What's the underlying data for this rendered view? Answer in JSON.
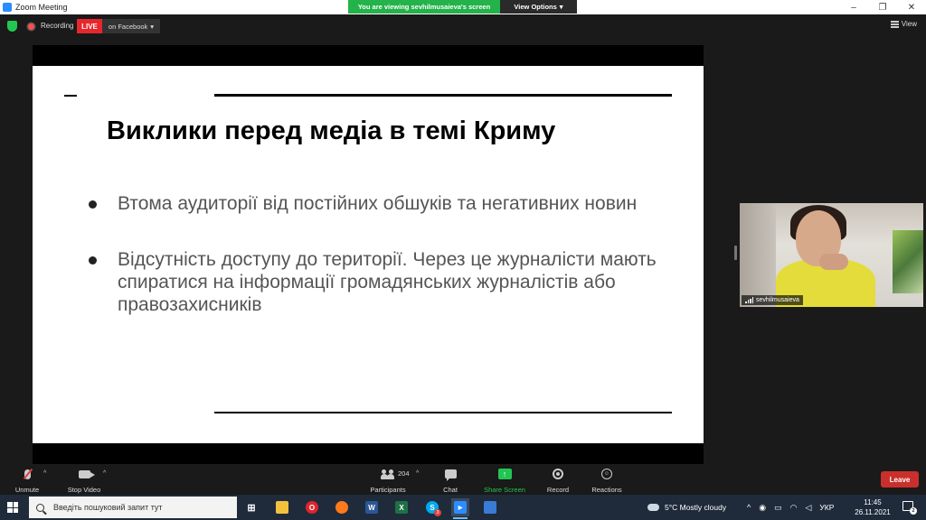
{
  "window": {
    "title": "Zoom Meeting",
    "controls": {
      "minimize": "–",
      "restore": "❐",
      "close": "✕"
    }
  },
  "share_banner": {
    "viewing_text": "You are viewing sevhilmusaieva's screen",
    "view_options_label": "View Options",
    "chevron": "▾"
  },
  "meeting": {
    "recording_label": "Recording",
    "live_label": "LIVE",
    "live_destination": "on Facebook",
    "dropdown_chevron": "▾",
    "view_label": "View"
  },
  "slide": {
    "heading": "Виклики перед медіа в темі Криму",
    "bullets": [
      "Втома аудиторії від постійних обшуків та негативних новин",
      "Відсутність доступу до території. Через це журналісти мають спиратися на інформації громадянських журналістів або правозахисників"
    ]
  },
  "participant": {
    "name": "sevhilmusaieva"
  },
  "toolbar": {
    "unmute_label": "Unmute",
    "stop_video_label": "Stop Video",
    "participants_label": "Participants",
    "participants_count": "204",
    "chat_label": "Chat",
    "share_screen_label": "Share Screen",
    "share_screen_glyph": "↑",
    "record_label": "Record",
    "reactions_label": "Reactions",
    "reactions_glyph": "☺",
    "leave_label": "Leave",
    "caret": "^",
    "colors": {
      "accent_green": "#23c552",
      "leave_red": "#c9302c",
      "live_red": "#e8262d"
    }
  },
  "taskbar": {
    "search_placeholder": "Введіть пошуковий запит тут",
    "skype_badge": "3",
    "weather": "5°C  Mostly cloudy",
    "tray_chevron": "^",
    "language": "УКР",
    "time": "11:45",
    "date": "26.11.2021",
    "notification_count": "2",
    "app_glyphs": {
      "task_view": "⊞",
      "word": "W",
      "excel": "X",
      "skype": "S",
      "zoom": "▶",
      "opera": "O"
    }
  }
}
